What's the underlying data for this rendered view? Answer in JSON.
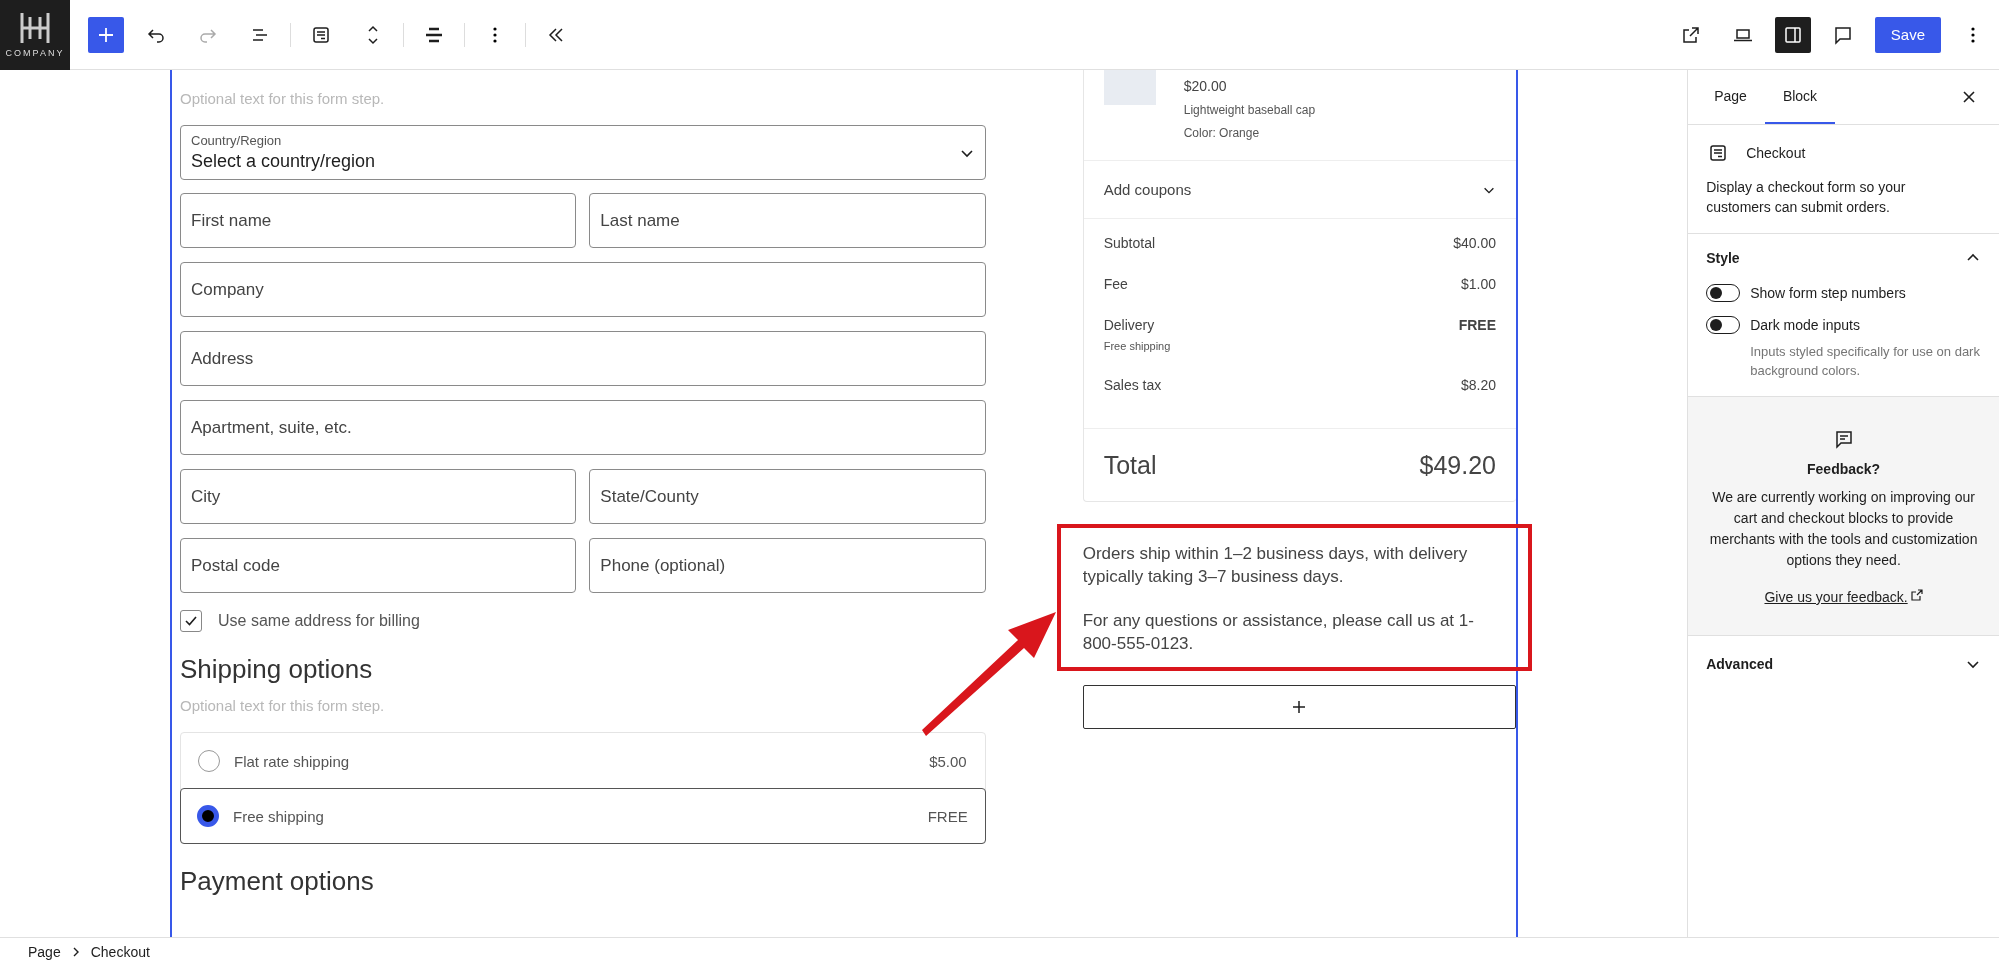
{
  "toolbar": {
    "logo_text": "COMPANY",
    "save": "Save"
  },
  "form": {
    "step_note": "Optional text for this form step.",
    "country": {
      "label": "Country/Region",
      "value": "Select a country/region"
    },
    "fields": [
      {
        "placeholder": "First name",
        "kind": "half"
      },
      {
        "placeholder": "Last name",
        "kind": "half"
      },
      {
        "placeholder": "Company",
        "kind": "full"
      },
      {
        "placeholder": "Address",
        "kind": "full"
      },
      {
        "placeholder": "Apartment, suite, etc.",
        "kind": "full"
      },
      {
        "placeholder": "City",
        "kind": "half"
      },
      {
        "placeholder": "State/County",
        "kind": "half"
      },
      {
        "placeholder": "Postal code",
        "kind": "half"
      },
      {
        "placeholder": "Phone (optional)",
        "kind": "half"
      }
    ],
    "billing": {
      "label": "Use same address for billing",
      "checked": true
    },
    "shipping": {
      "title": "Shipping options",
      "note": "Optional text for this form step.",
      "options": [
        {
          "label": "Flat rate shipping",
          "price": "$5.00",
          "selected": false
        },
        {
          "label": "Free shipping",
          "price": "FREE",
          "selected": true
        }
      ]
    },
    "payment": {
      "title": "Payment options"
    }
  },
  "summary": {
    "item": {
      "price": "$20.00",
      "description": "Lightweight baseball cap",
      "detail": "Color: Orange"
    },
    "coupons": {
      "label": "Add coupons",
      "expanded": false
    },
    "lines": [
      {
        "label": "Subtotal",
        "value": "$40.00",
        "bold": false
      },
      {
        "label": "Fee",
        "value": "$1.00",
        "bold": false
      },
      {
        "label": "Delivery",
        "value": "FREE",
        "bold": true,
        "note": "Free shipping"
      },
      {
        "label": "Sales tax",
        "value": "$8.20",
        "bold": false
      }
    ],
    "total": {
      "label": "Total",
      "value": "$49.20"
    },
    "notes": [
      "Orders ship within 1–2 business days, with delivery typically taking 3–7 business days.",
      "For any questions or assistance, please call us at 1-800-555-0123."
    ]
  },
  "sidebar": {
    "tabs": [
      {
        "label": "Page",
        "selected": false
      },
      {
        "label": "Block",
        "selected": true
      }
    ],
    "block": {
      "title": "Checkout",
      "description": "Display a checkout form so your customers can submit orders."
    },
    "style": {
      "title": "Style",
      "expanded": true,
      "toggles": [
        {
          "label": "Show form step numbers",
          "on": false
        },
        {
          "label": "Dark mode inputs",
          "on": false,
          "help": "Inputs styled specifically for use on dark background colors."
        }
      ]
    },
    "feedback": {
      "title": "Feedback?",
      "body": "We are currently working on improving our cart and checkout blocks to provide merchants with the tools and customization options they need.",
      "link": "Give us your feedback."
    },
    "advanced": {
      "title": "Advanced",
      "expanded": false
    }
  },
  "breadcrumb": [
    "Page",
    "Checkout"
  ]
}
